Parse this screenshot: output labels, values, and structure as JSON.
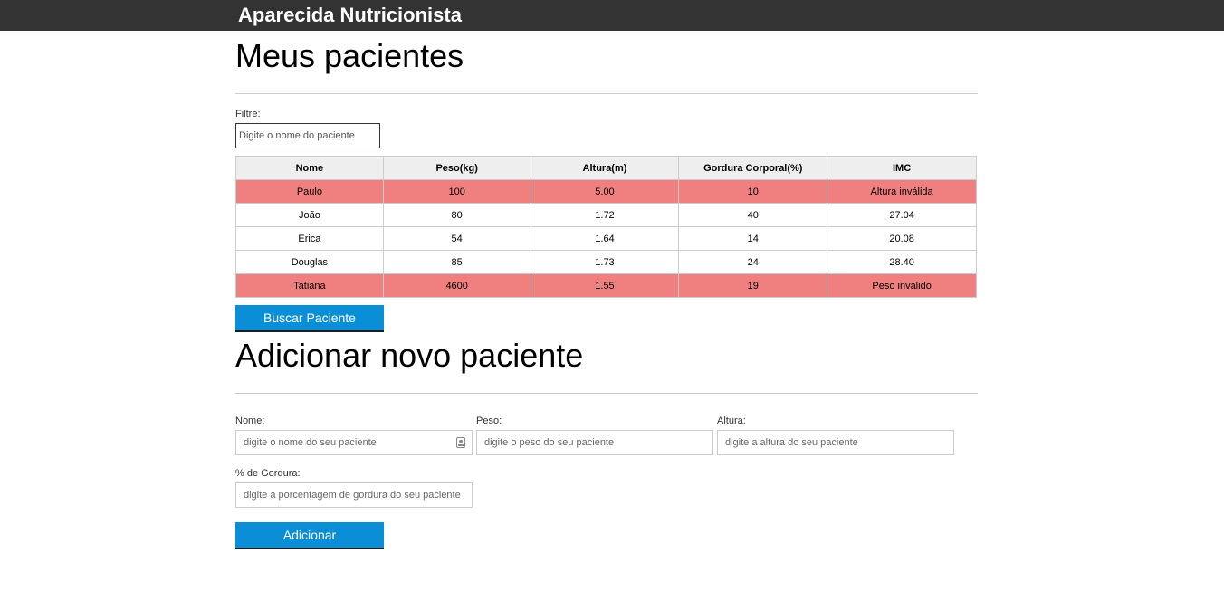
{
  "header": {
    "title": "Aparecida Nutricionista"
  },
  "patients_section": {
    "title": "Meus pacientes",
    "filter_label": "Filtre:",
    "filter_placeholder": "Digite o nome do paciente",
    "table": {
      "columns": [
        "Nome",
        "Peso(kg)",
        "Altura(m)",
        "Gordura Corporal(%)",
        "IMC"
      ],
      "rows": [
        {
          "nome": "Paulo",
          "peso": "100",
          "altura": "5.00",
          "gordura": "10",
          "imc": "Altura inválida",
          "invalid": true
        },
        {
          "nome": "João",
          "peso": "80",
          "altura": "1.72",
          "gordura": "40",
          "imc": "27.04",
          "invalid": false
        },
        {
          "nome": "Erica",
          "peso": "54",
          "altura": "1.64",
          "gordura": "14",
          "imc": "20.08",
          "invalid": false
        },
        {
          "nome": "Douglas",
          "peso": "85",
          "altura": "1.73",
          "gordura": "24",
          "imc": "28.40",
          "invalid": false
        },
        {
          "nome": "Tatiana",
          "peso": "4600",
          "altura": "1.55",
          "gordura": "19",
          "imc": "Peso inválido",
          "invalid": true
        }
      ]
    },
    "search_button": "Buscar Paciente"
  },
  "add_section": {
    "title": "Adicionar novo paciente",
    "fields": {
      "nome": {
        "label": "Nome:",
        "placeholder": "digite o nome do seu paciente"
      },
      "peso": {
        "label": "Peso:",
        "placeholder": "digite o peso do seu paciente"
      },
      "altura": {
        "label": "Altura:",
        "placeholder": "digite a altura do seu paciente"
      },
      "gordura": {
        "label": "% de Gordura:",
        "placeholder": "digite a porcentagem de gordura do seu paciente"
      }
    },
    "add_button": "Adicionar"
  },
  "colors": {
    "header_bg": "#333333",
    "invalid_row": "#f08080",
    "button_bg": "#0a8fd6",
    "table_header_bg": "#eeeeee"
  }
}
